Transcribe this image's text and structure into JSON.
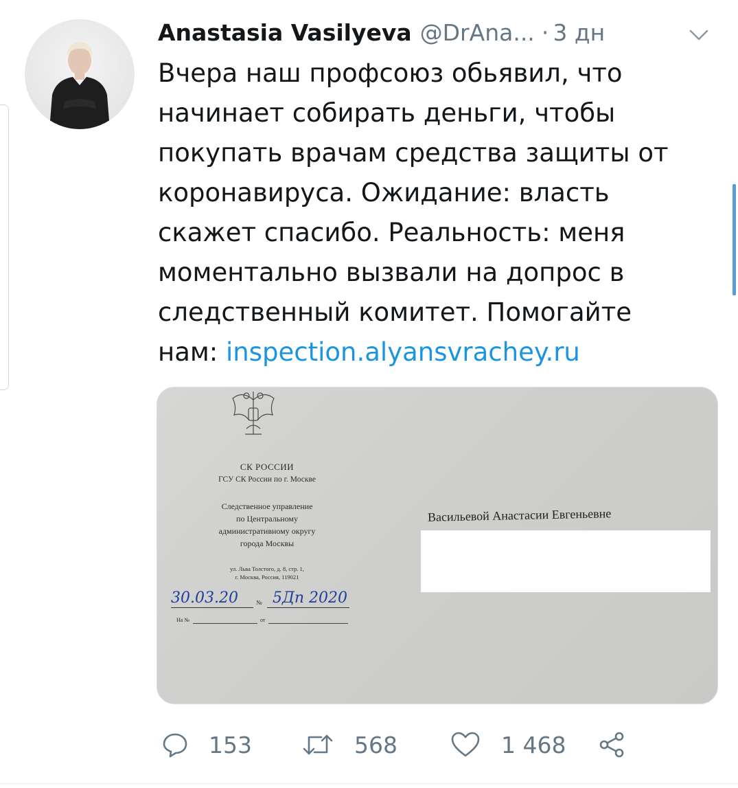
{
  "tweet": {
    "author": {
      "display_name": "Anastasia Vasilyeva",
      "handle": "@DrAna...",
      "avatar_icon": "profile-photo"
    },
    "separator": "·",
    "time": "3 дн",
    "text": {
      "lines": [
        "Вчера наш профсоюз обьявил, что",
        "начинает собирать деньги, чтобы",
        "покупать врачам средства защиты от",
        "коронавируса. Ожидание: власть",
        "скажет спасибо. Реальность: меня",
        "моментально вызвали на допрос в",
        "следственный комитет. Помогайте"
      ],
      "last_line_prefix": "нам: ",
      "link": "inspection.alyansvrachey.ru"
    },
    "media": {
      "emblem_icon": "coat-of-arms-icon",
      "org_line_1": "СК РОССИИ",
      "org_line_2": "ГСУ СК России по г. Москве",
      "department_lines": [
        "Следственное управление",
        "по Центральному",
        "административному округу",
        "города Москвы"
      ],
      "address_lines": [
        "ул. Льва Толстого, д. 8, стр. 1,",
        "г. Москва, Россия, 119021"
      ],
      "handwritten_date": "30.03.20",
      "number_label": "№",
      "handwritten_number": "5Дп 2020",
      "na_label": "На №",
      "ot_label": "от",
      "recipient": "Васильевой Анастасии Евгеньевне"
    },
    "actions": {
      "reply_count": "153",
      "retweet_count": "568",
      "like_count": "1 468"
    },
    "colors": {
      "link": "#1b95e0",
      "muted": "#657786",
      "text": "#14171a",
      "handwriting": "#1f3d9a"
    }
  }
}
